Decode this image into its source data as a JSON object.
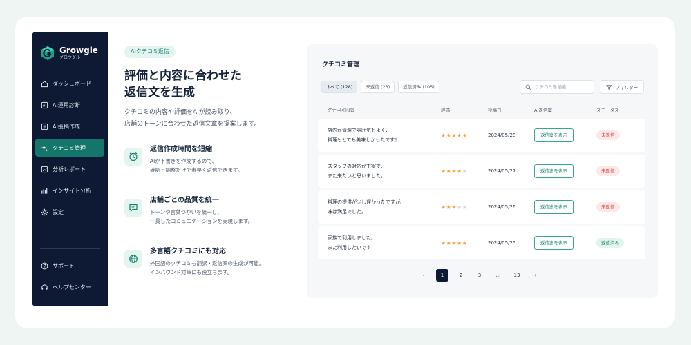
{
  "brand": {
    "name": "Growgle",
    "sub": "グロウグル"
  },
  "sidebar": {
    "items": [
      {
        "label": "ダッシュボード",
        "icon": "home-icon"
      },
      {
        "label": "AI運用診断",
        "icon": "ai-diagnosis-icon"
      },
      {
        "label": "AI投稿作成",
        "icon": "ai-post-icon"
      },
      {
        "label": "クチコミ管理",
        "icon": "sparkle-icon",
        "active": true
      },
      {
        "label": "分析レポート",
        "icon": "report-icon"
      },
      {
        "label": "インサイト分析",
        "icon": "bar-chart-icon"
      },
      {
        "label": "設定",
        "icon": "gear-icon"
      }
    ],
    "bottom": [
      {
        "label": "サポート",
        "icon": "help-icon"
      },
      {
        "label": "ヘルプセンター",
        "icon": "headset-icon"
      }
    ]
  },
  "hero": {
    "badge": "AIクチコミ返信",
    "headline_1": "評価と内容に合わせた",
    "headline_2": "返信文を生成",
    "lead_1": "クチコミの内容や評価をAIが読み取り、",
    "lead_2": "店舗のトーンに合わせた返信文章を提案します。"
  },
  "features": [
    {
      "title": "返信作成時間を短縮",
      "desc": "AIが下書きを作成するので、\n確認・調整だけで素早く返信できます。",
      "icon": "clock-icon"
    },
    {
      "title": "店舗ごとの品質を統一",
      "desc": "トーンや言葉づかいを統一し、\n一貫したコミュニケーションを実現します。",
      "icon": "chat-icon"
    },
    {
      "title": "多言語クチコミにも対応",
      "desc": "外国語のクチコミも翻訳・返信案の生成が可能。\nインバウンド対策にも役立ちます。",
      "icon": "globe-icon"
    }
  ],
  "panel": {
    "title": "クチコミ管理",
    "tabs": [
      "すべて (128)",
      "未返信 (23)",
      "返信済み (105)"
    ],
    "search_placeholder": "クチコミを検索",
    "filter_label": "フィルター",
    "columns": [
      "クチコミ内容",
      "評価",
      "投稿日",
      "AI返信案",
      "ステータス"
    ],
    "rows": [
      {
        "text_1": "店内が清潔で雰囲気もよく、",
        "text_2": "料理もとても美味しかったです！",
        "rating": 5,
        "date": "2024/05/28",
        "action": "返信案を表示",
        "status": "未返信",
        "status_type": "unreplied"
      },
      {
        "text_1": "スタッフの対応が丁寧で、",
        "text_2": "また来たいと思いました。",
        "rating": 4,
        "date": "2024/05/27",
        "action": "返信案を表示",
        "status": "未返信",
        "status_type": "unreplied"
      },
      {
        "text_1": "料理の提供が少し遅かったですが、",
        "text_2": "味は満足でした。",
        "rating": 3,
        "date": "2024/05/26",
        "action": "返信案を表示",
        "status": "未返信",
        "status_type": "unreplied"
      },
      {
        "text_1": "家族で利用しました。",
        "text_2": "また利用したいです！",
        "rating": 5,
        "date": "2024/05/25",
        "action": "返信案を表示",
        "status": "返信済み",
        "status_type": "replied"
      }
    ],
    "pagination": [
      "‹",
      "1",
      "2",
      "3",
      "...",
      "13",
      "›"
    ],
    "current_page": "1"
  },
  "colors": {
    "sidebar": "#0e1a33",
    "accent": "#14766a",
    "star": "#f2a03d",
    "unreplied": "#d0443d",
    "replied": "#17836f"
  }
}
